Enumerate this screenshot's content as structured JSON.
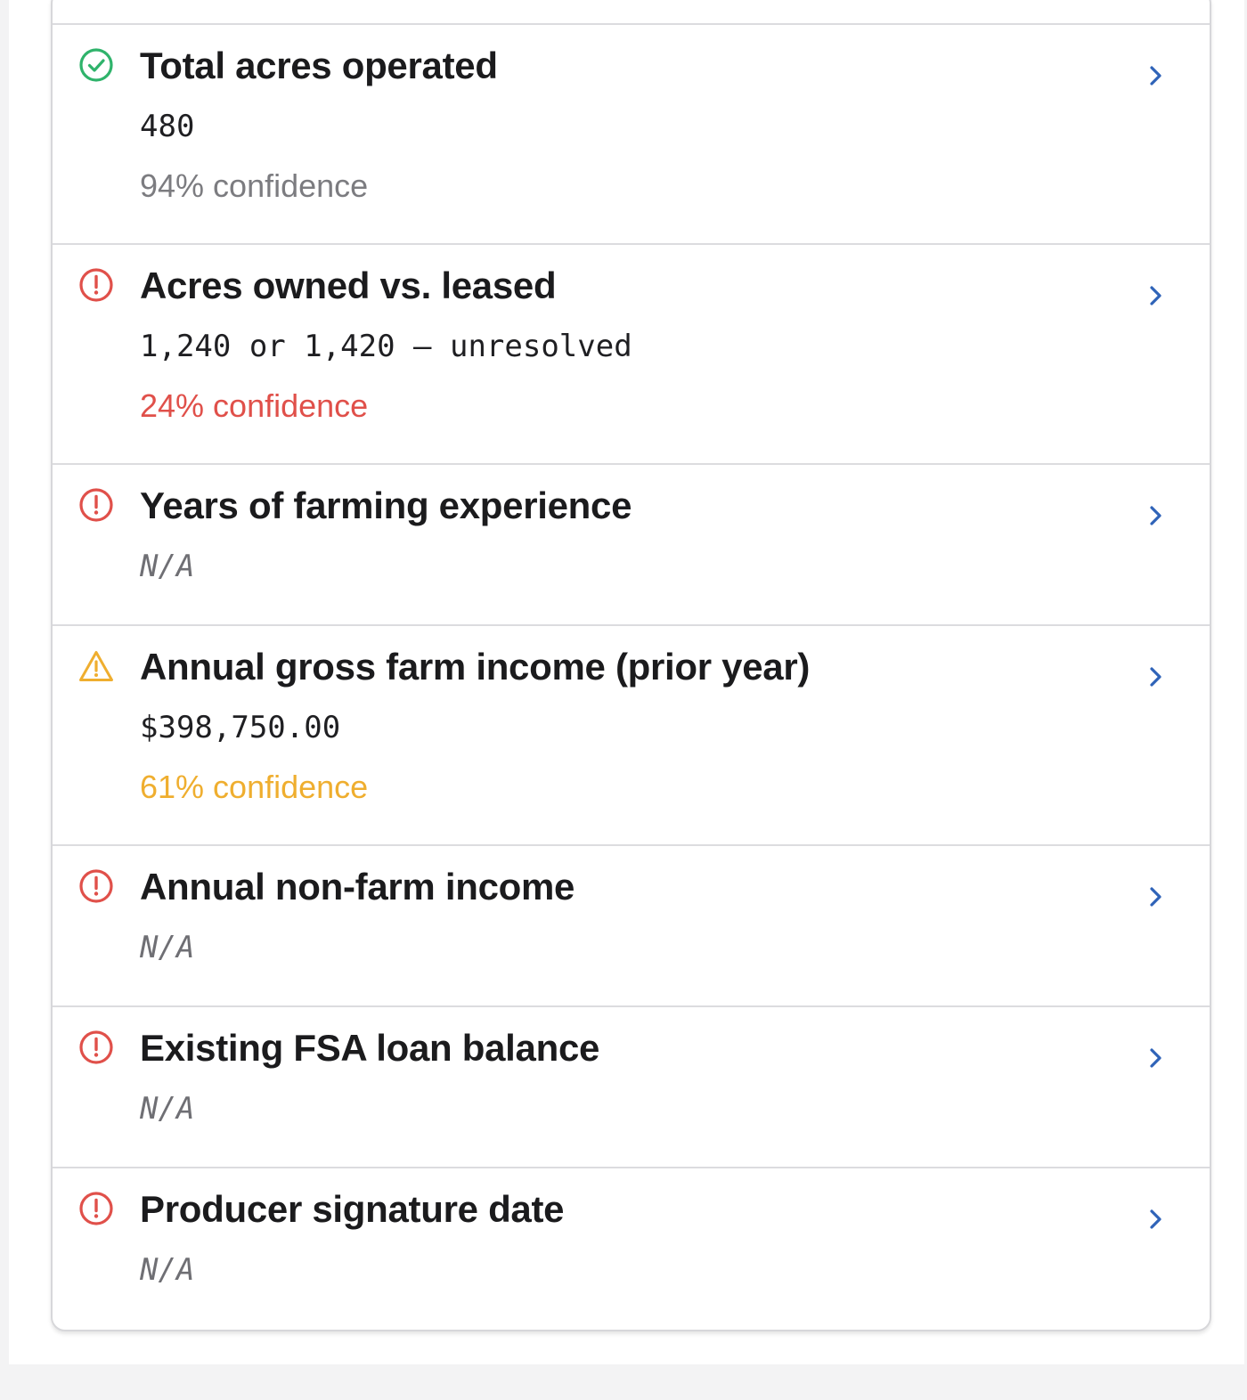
{
  "colors": {
    "ok": "#2fb36b",
    "error": "#e0504a",
    "warning": "#efae2f",
    "muted": "#7c7c80",
    "chevron": "#2f63b8"
  },
  "fields": [
    {
      "status": "ok",
      "status_icon": "check-circle-icon",
      "title": "Total acres operated",
      "value": "480",
      "confidence": "94% confidence",
      "confidence_level": "neutral"
    },
    {
      "status": "error",
      "status_icon": "alert-circle-icon",
      "title": "Acres owned vs. leased",
      "value": "1,240 or 1,420 — unresolved",
      "confidence": "24% confidence",
      "confidence_level": "low"
    },
    {
      "status": "error",
      "status_icon": "alert-circle-icon",
      "title": "Years of farming experience",
      "value": "N/A",
      "confidence": null,
      "confidence_level": null
    },
    {
      "status": "warning",
      "status_icon": "warning-triangle-icon",
      "title": "Annual gross farm income (prior year)",
      "value": "$398,750.00",
      "confidence": "61% confidence",
      "confidence_level": "medium"
    },
    {
      "status": "error",
      "status_icon": "alert-circle-icon",
      "title": "Annual non-farm income",
      "value": "N/A",
      "confidence": null,
      "confidence_level": null
    },
    {
      "status": "error",
      "status_icon": "alert-circle-icon",
      "title": "Existing FSA loan balance",
      "value": "N/A",
      "confidence": null,
      "confidence_level": null
    },
    {
      "status": "error",
      "status_icon": "alert-circle-icon",
      "title": "Producer signature date",
      "value": "N/A",
      "confidence": null,
      "confidence_level": null
    }
  ]
}
